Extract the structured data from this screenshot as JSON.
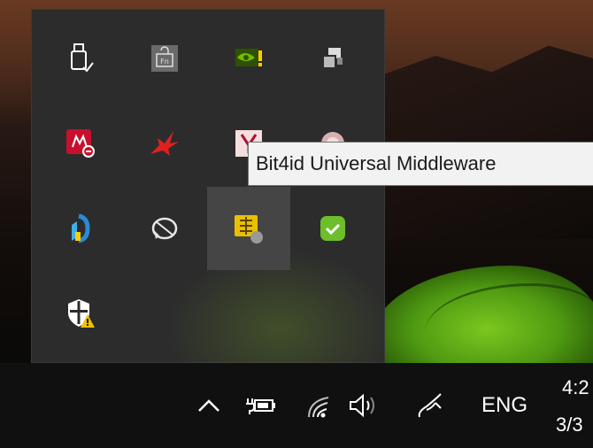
{
  "tooltip": {
    "text": "Bit4id Universal Middleware"
  },
  "taskbar": {
    "language": "ENG",
    "time": "4:2",
    "date": "3/3"
  },
  "flyout_icons": [
    "usb-safely-remove-icon",
    "function-key-icon",
    "nvidia-icon",
    "display-switch-icon",
    "mcafee-icon",
    "bird-app-icon",
    "yandex-icon",
    "app-circle-icon",
    "dell-icon",
    "realtek-audio-icon",
    "smartcard-middleware-icon",
    "check-shield-icon",
    "windows-security-warning-icon"
  ],
  "colors": {
    "flyout_bg": "#2c2c2c",
    "tooltip_bg": "#f2f2f2",
    "taskbar_bg": "#101010",
    "check_green": "#6cbf2a",
    "nvidia_green": "#76b900",
    "mcafee_red": "#c8102e"
  }
}
